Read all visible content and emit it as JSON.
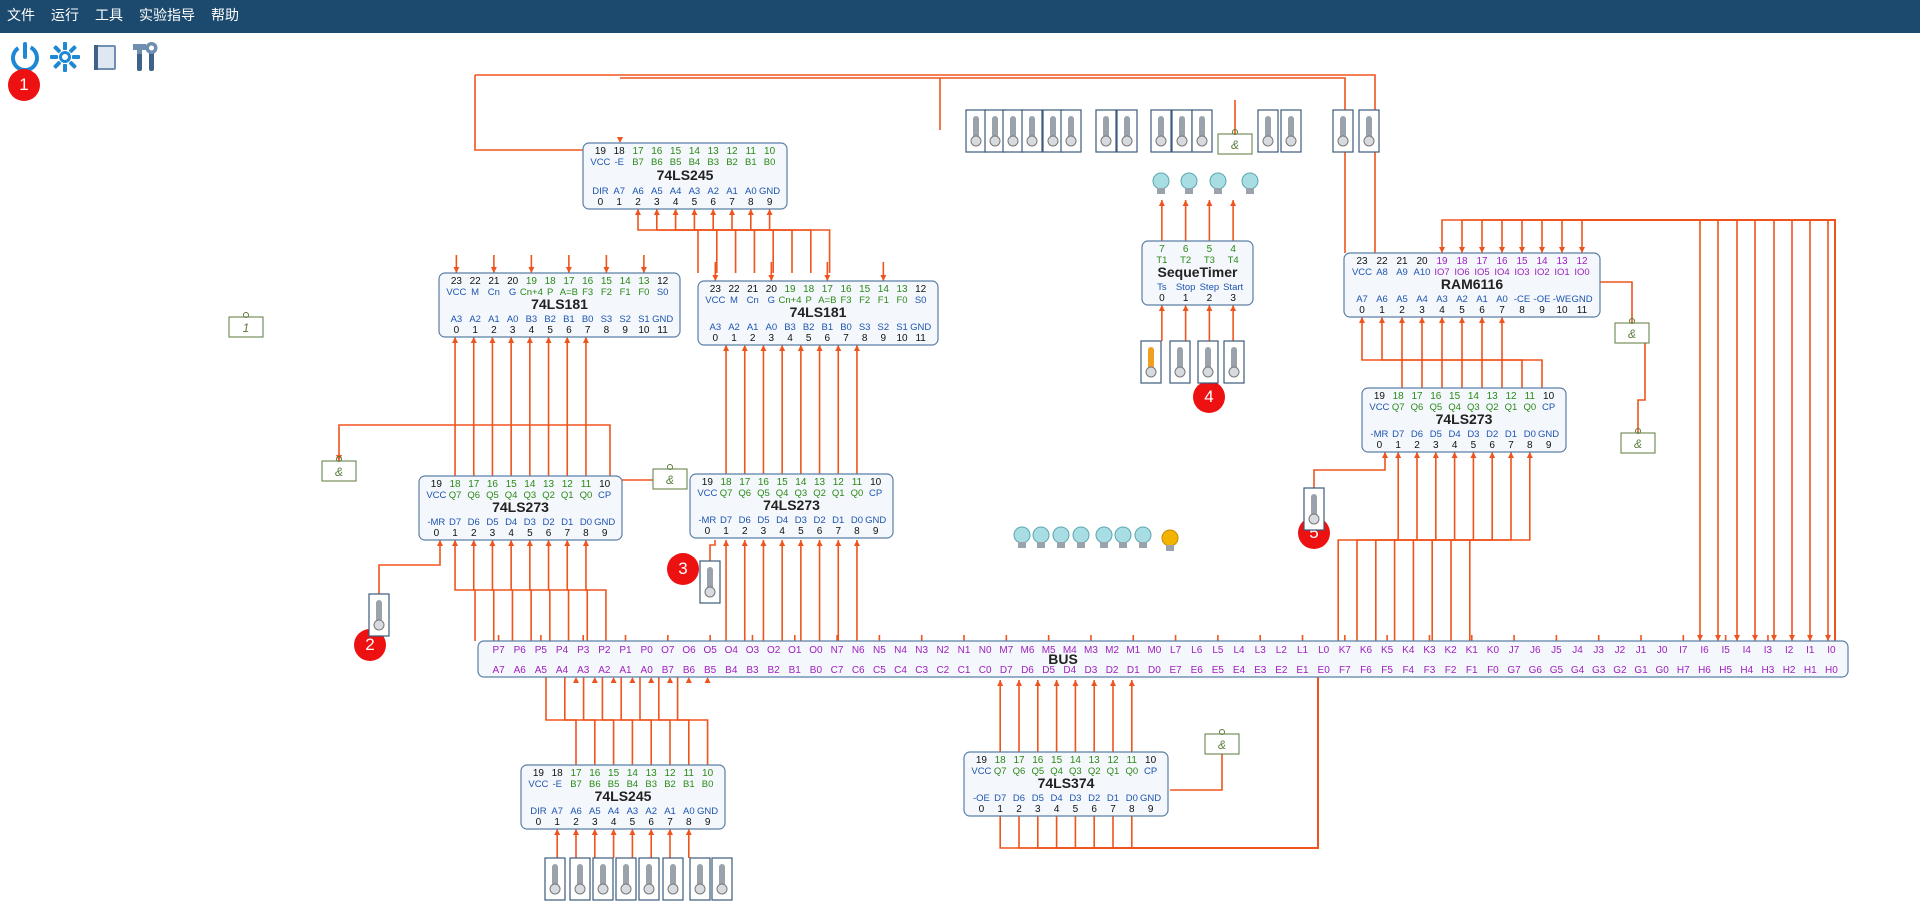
{
  "menu": [
    "文件",
    "运行",
    "工具",
    "实验指导",
    "帮助"
  ],
  "toolbar": [
    {
      "name": "power-icon",
      "title": "power"
    },
    {
      "name": "settings-gear-icon",
      "title": "settings"
    },
    {
      "name": "notebook-icon",
      "title": "notes"
    },
    {
      "name": "tools-icon",
      "title": "tools"
    }
  ],
  "badges": [
    "1",
    "2",
    "3",
    "4",
    "5"
  ],
  "chips": [
    {
      "id": "u245a",
      "title": "74LS245",
      "top_nums": [
        "19",
        "18",
        "17",
        "16",
        "15",
        "14",
        "13",
        "12",
        "11",
        "10"
      ],
      "top_sigs": [
        "VCC",
        "-E",
        "B7",
        "B6",
        "B5",
        "B4",
        "B3",
        "B2",
        "B1",
        "B0"
      ],
      "bot_sigs": [
        "DIR",
        "A7",
        "A6",
        "A5",
        "A4",
        "A3",
        "A2",
        "A1",
        "A0",
        "GND"
      ],
      "bot_nums": [
        "0",
        "1",
        "2",
        "3",
        "4",
        "5",
        "6",
        "7",
        "8",
        "9"
      ]
    },
    {
      "id": "u181a",
      "title": "74LS181",
      "top_nums": [
        "23",
        "22",
        "21",
        "20",
        "19",
        "18",
        "17",
        "16",
        "15",
        "14",
        "13",
        "12"
      ],
      "top_sigs": [
        "VCC",
        "M",
        "Cn",
        "G",
        "Cn+4",
        "P",
        "A=B",
        "F3",
        "F2",
        "F1",
        "F0",
        "S0"
      ],
      "bot_sigs": [
        "A3",
        "A2",
        "A1",
        "A0",
        "B3",
        "B2",
        "B1",
        "B0",
        "S3",
        "S2",
        "S1",
        "GND"
      ],
      "bot_nums": [
        "0",
        "1",
        "2",
        "3",
        "4",
        "5",
        "6",
        "7",
        "8",
        "9",
        "10",
        "11"
      ]
    },
    {
      "id": "u181b",
      "title": "74LS181",
      "top_nums": [
        "23",
        "22",
        "21",
        "20",
        "19",
        "18",
        "17",
        "16",
        "15",
        "14",
        "13",
        "12"
      ],
      "top_sigs": [
        "VCC",
        "M",
        "Cn",
        "G",
        "Cn+4",
        "P",
        "A=B",
        "F3",
        "F2",
        "F1",
        "F0",
        "S0"
      ],
      "bot_sigs": [
        "A3",
        "A2",
        "A1",
        "A0",
        "B3",
        "B2",
        "B1",
        "B0",
        "S3",
        "S2",
        "S1",
        "GND"
      ],
      "bot_nums": [
        "0",
        "1",
        "2",
        "3",
        "4",
        "5",
        "6",
        "7",
        "8",
        "9",
        "10",
        "11"
      ]
    },
    {
      "id": "u273a",
      "title": "74LS273",
      "top_nums": [
        "19",
        "18",
        "17",
        "16",
        "15",
        "14",
        "13",
        "12",
        "11",
        "10"
      ],
      "top_sigs": [
        "VCC",
        "Q7",
        "Q6",
        "Q5",
        "Q4",
        "Q3",
        "Q2",
        "Q1",
        "Q0",
        "CP"
      ],
      "bot_sigs": [
        "-MR",
        "D7",
        "D6",
        "D5",
        "D4",
        "D3",
        "D2",
        "D1",
        "D0",
        "GND"
      ],
      "bot_nums": [
        "0",
        "1",
        "2",
        "3",
        "4",
        "5",
        "6",
        "7",
        "8",
        "9"
      ]
    },
    {
      "id": "u273b",
      "title": "74LS273",
      "top_nums": [
        "19",
        "18",
        "17",
        "16",
        "15",
        "14",
        "13",
        "12",
        "11",
        "10"
      ],
      "top_sigs": [
        "VCC",
        "Q7",
        "Q6",
        "Q5",
        "Q4",
        "Q3",
        "Q2",
        "Q1",
        "Q0",
        "CP"
      ],
      "bot_sigs": [
        "-MR",
        "D7",
        "D6",
        "D5",
        "D4",
        "D3",
        "D2",
        "D1",
        "D0",
        "GND"
      ],
      "bot_nums": [
        "0",
        "1",
        "2",
        "3",
        "4",
        "5",
        "6",
        "7",
        "8",
        "9"
      ]
    },
    {
      "id": "useq",
      "title": "SequeTimer",
      "top_nums": [
        "7",
        "6",
        "5",
        "4"
      ],
      "top_sigs": [
        "T1",
        "T2",
        "T3",
        "T4"
      ],
      "bot_sigs": [
        "Ts",
        "Stop",
        "Step",
        "Start"
      ],
      "bot_nums": [
        "0",
        "1",
        "2",
        "3"
      ]
    },
    {
      "id": "uram",
      "title": "RAM6116",
      "top_nums": [
        "23",
        "22",
        "21",
        "20",
        "19",
        "18",
        "17",
        "16",
        "15",
        "14",
        "13",
        "12"
      ],
      "top_sigs": [
        "VCC",
        "A8",
        "A9",
        "A10",
        "IO7",
        "IO6",
        "IO5",
        "IO4",
        "IO3",
        "IO2",
        "IO1",
        "IO0"
      ],
      "bot_sigs": [
        "A7",
        "A6",
        "A5",
        "A4",
        "A3",
        "A2",
        "A1",
        "A0",
        "-CE",
        "-OE",
        "-WE",
        "GND"
      ],
      "bot_nums": [
        "0",
        "1",
        "2",
        "3",
        "4",
        "5",
        "6",
        "7",
        "8",
        "9",
        "10",
        "11"
      ]
    },
    {
      "id": "u273c",
      "title": "74LS273",
      "top_nums": [
        "19",
        "18",
        "17",
        "16",
        "15",
        "14",
        "13",
        "12",
        "11",
        "10"
      ],
      "top_sigs": [
        "VCC",
        "Q7",
        "Q6",
        "Q5",
        "Q4",
        "Q3",
        "Q2",
        "Q1",
        "Q0",
        "CP"
      ],
      "bot_sigs": [
        "-MR",
        "D7",
        "D6",
        "D5",
        "D4",
        "D3",
        "D2",
        "D1",
        "D0",
        "GND"
      ],
      "bot_nums": [
        "0",
        "1",
        "2",
        "3",
        "4",
        "5",
        "6",
        "7",
        "8",
        "9"
      ]
    },
    {
      "id": "u245b",
      "title": "74LS245",
      "top_nums": [
        "19",
        "18",
        "17",
        "16",
        "15",
        "14",
        "13",
        "12",
        "11",
        "10"
      ],
      "top_sigs": [
        "VCC",
        "-E",
        "B7",
        "B6",
        "B5",
        "B4",
        "B3",
        "B2",
        "B1",
        "B0"
      ],
      "bot_sigs": [
        "DIR",
        "A7",
        "A6",
        "A5",
        "A4",
        "A3",
        "A2",
        "A1",
        "A0",
        "GND"
      ],
      "bot_nums": [
        "0",
        "1",
        "2",
        "3",
        "4",
        "5",
        "6",
        "7",
        "8",
        "9"
      ]
    },
    {
      "id": "u374",
      "title": "74LS374",
      "top_nums": [
        "19",
        "18",
        "17",
        "16",
        "15",
        "14",
        "13",
        "12",
        "11",
        "10"
      ],
      "top_sigs": [
        "VCC",
        "Q7",
        "Q6",
        "Q5",
        "Q4",
        "Q3",
        "Q2",
        "Q1",
        "Q0",
        "CP"
      ],
      "bot_sigs": [
        "-OE",
        "D7",
        "D6",
        "D5",
        "D4",
        "D3",
        "D2",
        "D1",
        "D0",
        "GND"
      ],
      "bot_nums": [
        "0",
        "1",
        "2",
        "3",
        "4",
        "5",
        "6",
        "7",
        "8",
        "9"
      ]
    }
  ],
  "bus": {
    "title": "BUS",
    "top": [
      "P7",
      "P6",
      "P5",
      "P4",
      "P3",
      "P2",
      "P1",
      "P0",
      "O7",
      "O6",
      "O5",
      "O4",
      "O3",
      "O2",
      "O1",
      "O0",
      "N7",
      "N6",
      "N5",
      "N4",
      "N3",
      "N2",
      "N1",
      "N0",
      "M7",
      "M6",
      "M5",
      "M4",
      "M3",
      "M2",
      "M1",
      "M0",
      "L7",
      "L6",
      "L5",
      "L4",
      "L3",
      "L2",
      "L1",
      "L0",
      "K7",
      "K6",
      "K5",
      "K4",
      "K3",
      "K2",
      "K1",
      "K0",
      "J7",
      "J6",
      "J5",
      "J4",
      "J3",
      "J2",
      "J1",
      "J0",
      "I7",
      "I6",
      "I5",
      "I4",
      "I3",
      "I2",
      "I1",
      "I0"
    ],
    "bottom": [
      "A7",
      "A6",
      "A5",
      "A4",
      "A3",
      "A2",
      "A1",
      "A0",
      "B7",
      "B6",
      "B5",
      "B4",
      "B3",
      "B2",
      "B1",
      "B0",
      "C7",
      "C6",
      "C5",
      "C4",
      "C3",
      "C2",
      "C1",
      "C0",
      "D7",
      "D6",
      "D5",
      "D4",
      "D3",
      "D2",
      "D1",
      "D0",
      "E7",
      "E6",
      "E5",
      "E4",
      "E3",
      "E2",
      "E1",
      "E0",
      "F7",
      "F6",
      "F5",
      "F4",
      "F3",
      "F2",
      "F1",
      "F0",
      "G7",
      "G6",
      "G5",
      "G4",
      "G3",
      "G2",
      "G1",
      "G0",
      "H7",
      "H6",
      "H5",
      "H4",
      "H3",
      "H2",
      "H1",
      "H0"
    ]
  },
  "gates": {
    "and": "&",
    "not": "1"
  },
  "colors": {
    "wire": "#f0541e",
    "chip_border": "#5a7fa6",
    "chip_fill": "#f4f7fb",
    "pin_number": "#111111",
    "pin_green": "#2a8a16",
    "pin_blue": "#1d55b0",
    "pin_purple": "#a020c0",
    "menubar": "#1b4a6e",
    "badge": "#ee1111",
    "lamp_on": "#f3b400",
    "lamp_off": "#a8dde3"
  }
}
